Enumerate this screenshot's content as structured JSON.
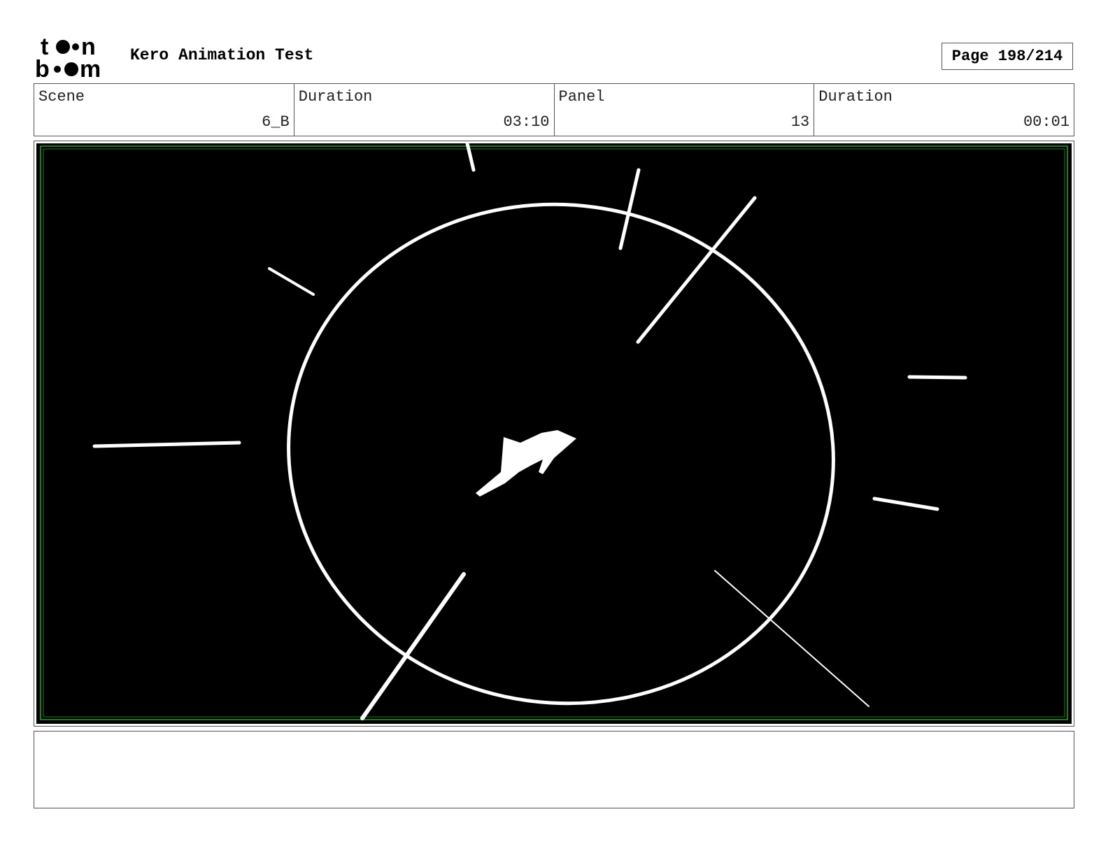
{
  "header": {
    "logo_top": "t",
    "logo_top_end": "n",
    "logo_bottom_start": "b",
    "logo_bottom_end": "m",
    "project_title": "Kero Animation Test",
    "page_indicator": "Page 198/214"
  },
  "info": {
    "scene_label": "Scene",
    "scene_value": "6_B",
    "scene_duration_label": "Duration",
    "scene_duration_value": "03:10",
    "panel_label": "Panel",
    "panel_value": "13",
    "panel_duration_label": "Duration",
    "panel_duration_value": "00:01"
  },
  "panel": {
    "background_color": "#000000",
    "stroke_color": "#ffffff",
    "safe_frame_color": "#1f7a1f"
  },
  "notes": {
    "text": ""
  }
}
